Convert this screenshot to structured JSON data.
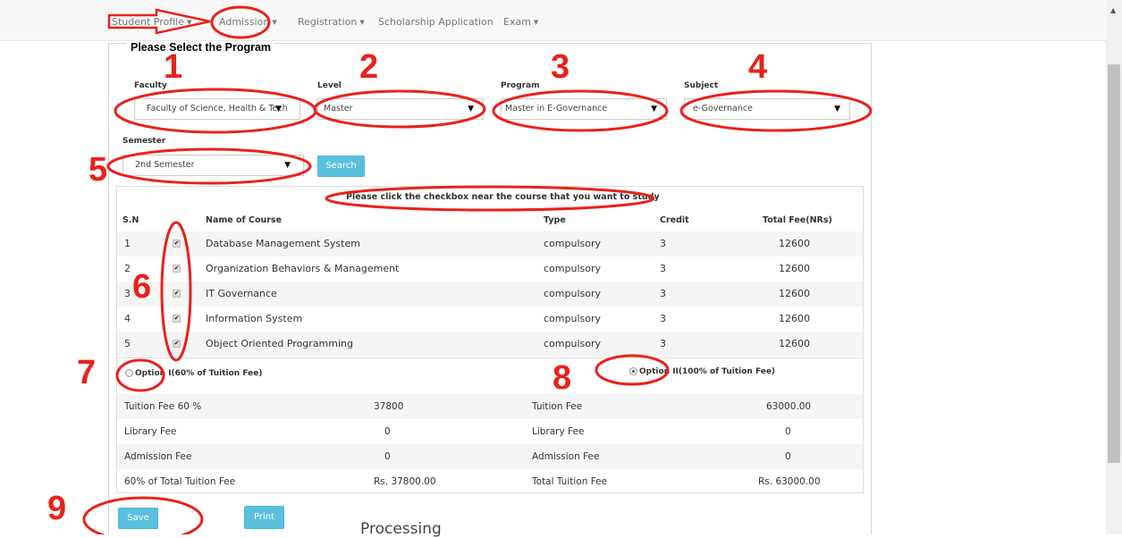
{
  "nav": {
    "items": [
      {
        "label": "Student Profile",
        "dropdown": false
      },
      {
        "label": "Admission",
        "dropdown": true
      },
      {
        "label": "Registration",
        "dropdown": true
      },
      {
        "label": "Scholarship Application",
        "dropdown": false
      },
      {
        "label": "Exam",
        "dropdown": true
      }
    ]
  },
  "form": {
    "legend": "Please Select the Program",
    "faculty": {
      "label": "Faculty",
      "value": "Faculty of Science, Health & Tech"
    },
    "level": {
      "label": "Level",
      "value": "Master"
    },
    "program": {
      "label": "Program",
      "value": "Master in E-Governance"
    },
    "subject": {
      "label": "Subject",
      "value": "e-Governance"
    },
    "semester": {
      "label": "Semester",
      "value": "2nd Semester"
    },
    "search_label": "Search"
  },
  "courses": {
    "instruction": "Please click the checkbox near the course that you want to study",
    "headers": [
      "S.N",
      "Name of Course",
      "Type",
      "Credit",
      "Total Fee(NRs)"
    ],
    "rows": [
      {
        "sn": "1",
        "checked": true,
        "name": "Database Management System",
        "type": "compulsory",
        "credit": "3",
        "fee": "12600"
      },
      {
        "sn": "2",
        "checked": true,
        "name": "Organization Behaviors & Management",
        "type": "compulsory",
        "credit": "3",
        "fee": "12600"
      },
      {
        "sn": "3",
        "checked": true,
        "name": "IT Governance",
        "type": "compulsory",
        "credit": "3",
        "fee": "12600"
      },
      {
        "sn": "4",
        "checked": true,
        "name": "Information System",
        "type": "compulsory",
        "credit": "3",
        "fee": "12600"
      },
      {
        "sn": "5",
        "checked": true,
        "name": "Object Oriented Programming",
        "type": "compulsory",
        "credit": "3",
        "fee": "12600"
      }
    ]
  },
  "options": {
    "option1": {
      "label": "Option I(60% of Tuition Fee)",
      "selected": false
    },
    "option2": {
      "label": "Option II(100% of Tuition Fee)",
      "selected": true
    }
  },
  "fees": {
    "left": [
      {
        "label": "Tuition Fee 60 %",
        "value": "37800"
      },
      {
        "label": "Library Fee",
        "value": "0"
      },
      {
        "label": "Admission Fee",
        "value": "0"
      },
      {
        "label": "60% of Total Tuition Fee",
        "value": "Rs. 37800.00"
      }
    ],
    "right": [
      {
        "label": "Tuition Fee",
        "value": "63000.00"
      },
      {
        "label": "Library Fee",
        "value": "0"
      },
      {
        "label": "Admission Fee",
        "value": "0"
      },
      {
        "label": "Total Tuition Fee",
        "value": "Rs. 63000.00"
      }
    ]
  },
  "actions": {
    "save_label": "Save",
    "print_label": "Print"
  },
  "status_text": "Processing",
  "annotations": {
    "numbers": [
      "1",
      "2",
      "3",
      "4",
      "5",
      "6",
      "7",
      "8",
      "9"
    ],
    "color": "#e8221b"
  }
}
